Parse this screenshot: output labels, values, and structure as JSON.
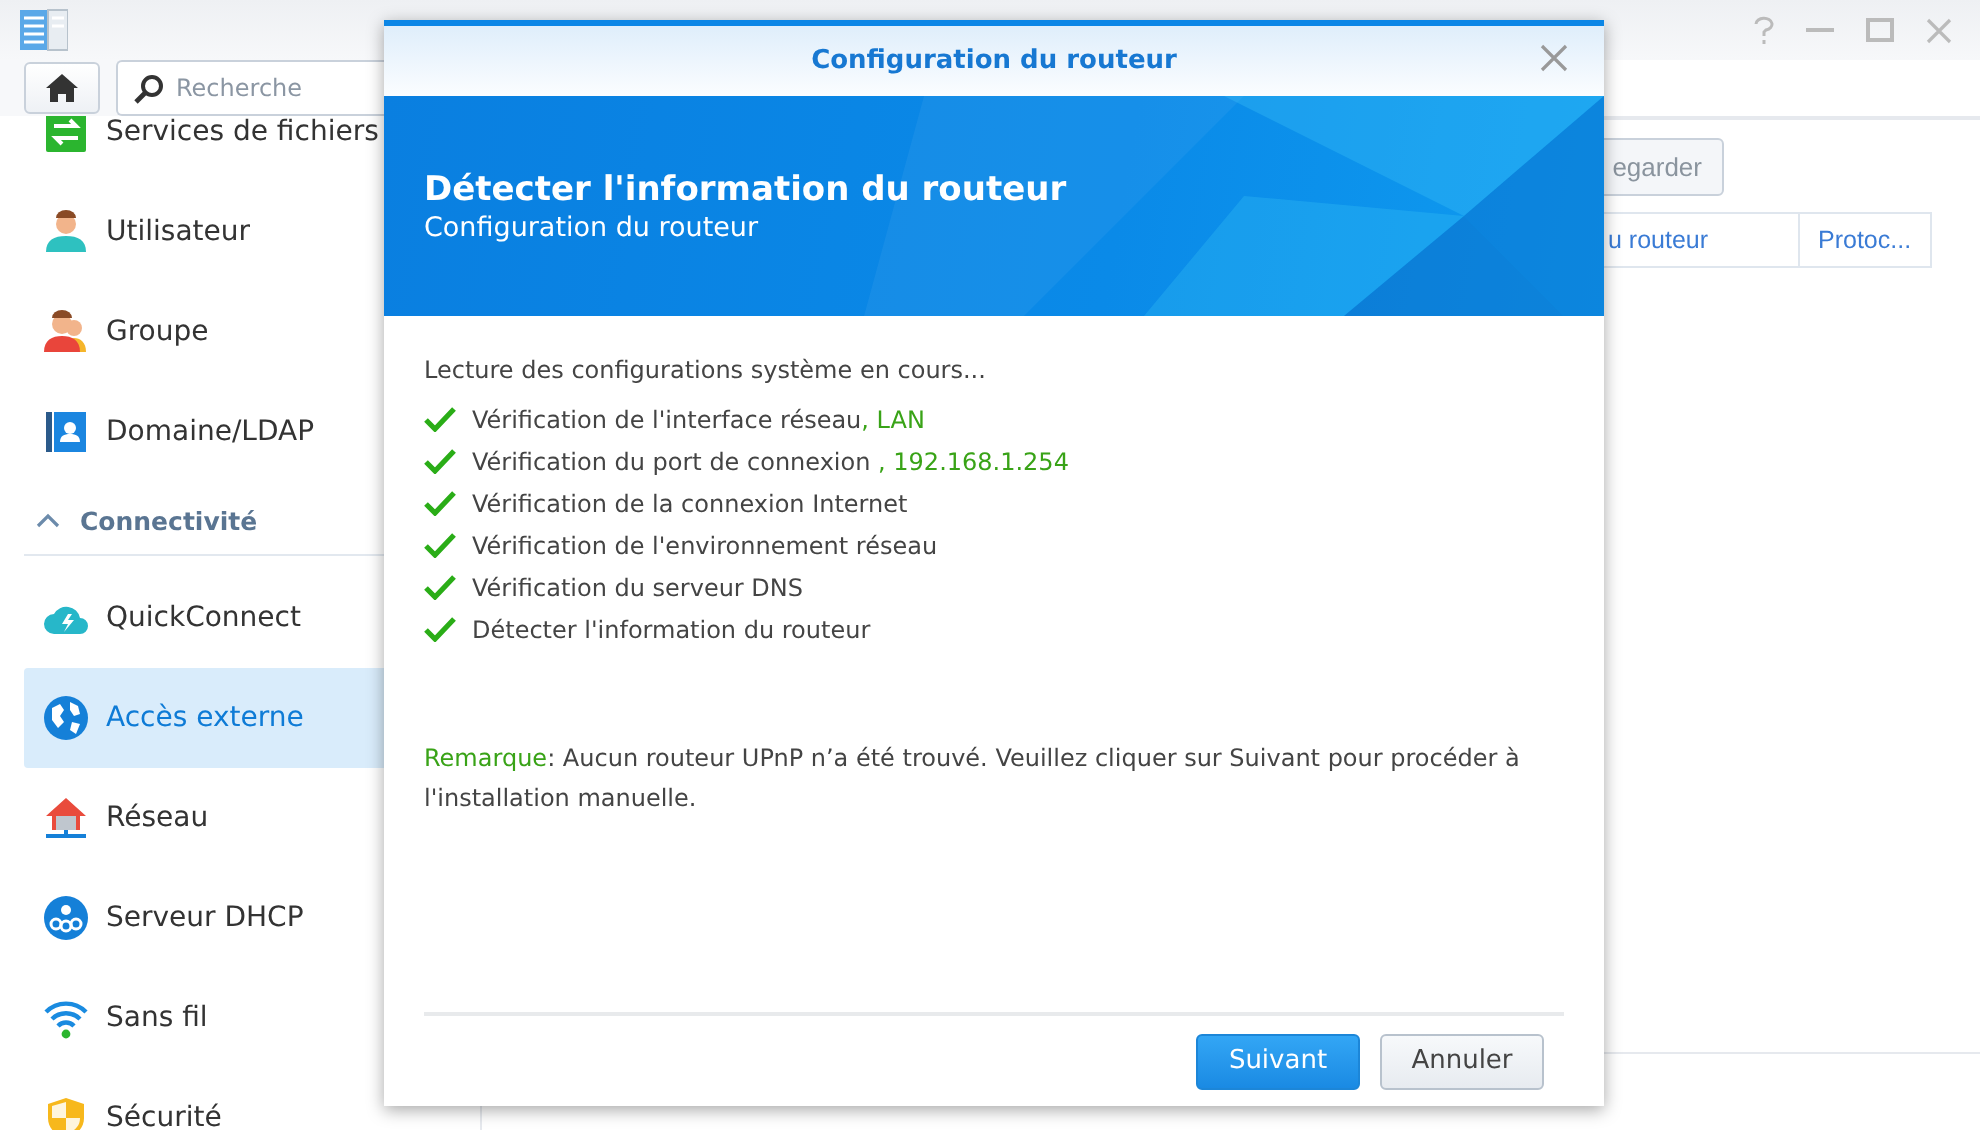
{
  "app": {
    "search": {
      "placeholder": "Recherche"
    },
    "sidebar": {
      "items": [
        {
          "label": "Services de fichiers",
          "selected": false
        },
        {
          "label": "Utilisateur",
          "selected": false
        },
        {
          "label": "Groupe",
          "selected": false
        },
        {
          "label": "Domaine/LDAP",
          "selected": false
        },
        {
          "kind": "section",
          "label": "Connectivité",
          "expanded": true
        },
        {
          "label": "QuickConnect",
          "selected": false
        },
        {
          "label": "Accès externe",
          "selected": true
        },
        {
          "label": "Réseau",
          "selected": false
        },
        {
          "label": "Serveur DHCP",
          "selected": false
        },
        {
          "label": "Sans fil",
          "selected": false
        },
        {
          "label": "Sécurité",
          "selected": false
        }
      ]
    },
    "toolbar": {
      "button": "egarder"
    },
    "table": {
      "columns": [
        "u routeur",
        "Protoc..."
      ]
    }
  },
  "dialog": {
    "title": "Configuration du routeur",
    "heading": "Détecter l'information du routeur",
    "subheading": "Configuration du routeur",
    "intro": "Lecture des configurations système en cours...",
    "checks": [
      {
        "text": "Vérification de l'interface réseau",
        "detail": ", LAN",
        "done": true
      },
      {
        "text": "Vérification du port de connexion ",
        "detail": ", 192.168.1.254",
        "done": true
      },
      {
        "text": "Vérification de la connexion Internet",
        "done": true
      },
      {
        "text": "Vérification de l'environnement réseau",
        "done": true
      },
      {
        "text": "Vérification du serveur DNS",
        "done": true
      },
      {
        "text": "Détecter l'information du routeur",
        "done": true
      }
    ],
    "note": {
      "label": "Remarque",
      "text": ": Aucun routeur UPnP n’a été trouvé. Veuillez cliquer sur Suivant pour procéder à l'installation manuelle."
    },
    "buttons": [
      {
        "label": "Suivant",
        "primary": true
      },
      {
        "label": "Annuler",
        "primary": false
      }
    ]
  }
}
